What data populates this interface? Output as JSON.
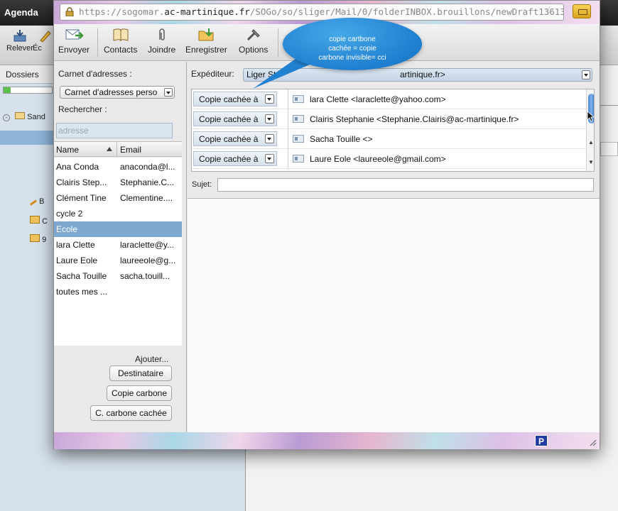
{
  "background_app": {
    "title": "Agenda",
    "toolbar": {
      "releve_label": "Relever",
      "ecrire_label": "Éc"
    },
    "dossiers_label": "Dossiers",
    "tree_items": [
      "Sand",
      "B",
      "C",
      "9"
    ]
  },
  "popup": {
    "url": {
      "prefix": "https://sogomar.",
      "domain": "ac-martinique.fr",
      "path": "/SOGo/so/sliger/Mail/0/folderINBOX.brouillons/newDraft13613"
    },
    "toolbar": {
      "envoyer": "Envoyer",
      "contacts": "Contacts",
      "joindre": "Joindre",
      "enregistrer": "Enregistrer",
      "options": "Options"
    },
    "tooltip": {
      "line1": "copie cartbone",
      "line2": "cachée = copie",
      "line3": "carbone invisible= cci"
    },
    "address_book": {
      "label": "Carnet d'adresses :",
      "selected_book": "Carnet d'adresses perso",
      "search_label": "Rechercher :",
      "search_placeholder": "adresse",
      "col_name": "Name",
      "col_email": "Email",
      "contacts": [
        {
          "name": "Ana Conda",
          "email": "anaconda@l..."
        },
        {
          "name": "Clairis Step...",
          "email": "Stephanie.C..."
        },
        {
          "name": "Clément Tine",
          "email": "Clementine...."
        },
        {
          "name": "cycle 2",
          "email": ""
        },
        {
          "name": "Ecole",
          "email": ""
        },
        {
          "name": "lara Clette",
          "email": "laraclette@y..."
        },
        {
          "name": "Laure Eole",
          "email": "laureeole@g..."
        },
        {
          "name": "Sacha Touille",
          "email": "sacha.touill..."
        },
        {
          "name": "toutes mes ...",
          "email": ""
        }
      ],
      "selected_index": 4,
      "add_label": "Ajouter...",
      "btn_destinataire": "Destinataire",
      "btn_copie_carbone": "Copie carbone",
      "btn_cc_cachee": "C. carbone cachée"
    },
    "composer": {
      "expediteur_label": "Expéditeur:",
      "expediteur_value_start": "Liger St",
      "expediteur_value_end": "artinique.fr>",
      "recipients": [
        {
          "type": "Copie cachée à",
          "value": "lara Clette <laraclette@yahoo.com>"
        },
        {
          "type": "Copie cachée à",
          "value": "Clairis Stephanie <Stephanie.Clairis@ac-martinique.fr>"
        },
        {
          "type": "Copie cachée à",
          "value": "Sacha Touille <>"
        },
        {
          "type": "Copie cachée à",
          "value": "Laure Eole <laureeole@gmail.com>"
        }
      ],
      "sujet_label": "Sujet:",
      "sujet_value": "",
      "body": ""
    },
    "status_p": "P"
  }
}
